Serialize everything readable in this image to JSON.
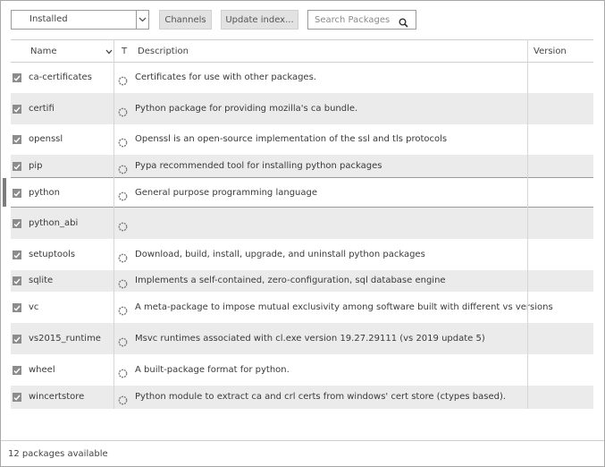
{
  "toolbar": {
    "filter_value": "Installed",
    "channels_label": "Channels",
    "update_index_label": "Update index...",
    "search_placeholder": "Search Packages"
  },
  "table": {
    "columns": {
      "name": "Name",
      "type": "T",
      "description": "Description",
      "version": "Version"
    },
    "rows": [
      {
        "name": "ca-certificates",
        "description": "Certificates for use with other packages.",
        "version": "",
        "checked": true
      },
      {
        "name": "certifi",
        "description": "Python package for providing mozilla's ca bundle.",
        "version": "",
        "checked": true
      },
      {
        "name": "openssl",
        "description": "Openssl is an open-source implementation of the ssl and tls protocols",
        "version": "",
        "checked": true
      },
      {
        "name": "pip",
        "description": "Pypa recommended tool for installing python packages",
        "version": "",
        "checked": true
      },
      {
        "name": "python",
        "description": "General purpose programming language",
        "version": "",
        "checked": true
      },
      {
        "name": "python_abi",
        "description": "",
        "version": "",
        "checked": true
      },
      {
        "name": "setuptools",
        "description": "Download, build, install, upgrade, and uninstall python packages",
        "version": "",
        "checked": true
      },
      {
        "name": "sqlite",
        "description": "Implements a self-contained, zero-configuration, sql database engine",
        "version": "",
        "checked": true
      },
      {
        "name": "vc",
        "description": "A meta-package to impose mutual exclusivity among software built with different vs versions",
        "version": "",
        "checked": true
      },
      {
        "name": "vs2015_runtime",
        "description": "Msvc runtimes associated with cl.exe version 19.27.29111 (vs 2019 update 5)",
        "version": "",
        "checked": true
      },
      {
        "name": "wheel",
        "description": "A built-package format for python.",
        "version": "",
        "checked": true
      },
      {
        "name": "wincertstore",
        "description": "Python module to extract ca and crl certs from windows' cert store (ctypes based).",
        "version": "",
        "checked": true
      }
    ]
  },
  "footer": {
    "status": "12 packages available"
  },
  "colors": {
    "row_alt": "#ebebeb",
    "checkbox": "#8c8c8c",
    "selected_marker": "#7d7d7d"
  },
  "icons": {
    "row_status": "status-ring-icon",
    "search": "search-icon",
    "dropdown": "chevron-down-icon",
    "sort": "chevron-down-icon"
  }
}
